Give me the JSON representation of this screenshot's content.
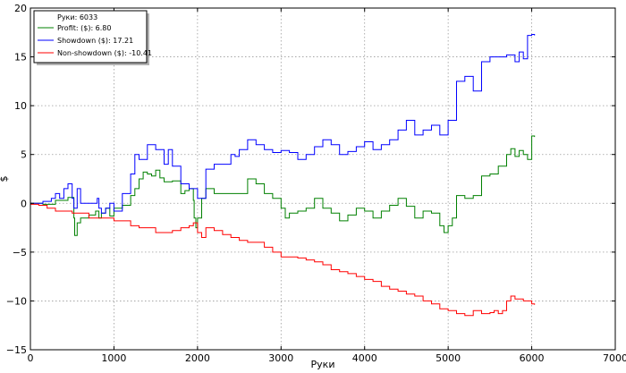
{
  "chart_data": {
    "type": "line",
    "xlabel": "Руки",
    "ylabel": "$",
    "xlim": [
      0,
      7000
    ],
    "ylim": [
      -15,
      20
    ],
    "xticks": [
      0,
      1000,
      2000,
      3000,
      4000,
      5000,
      6000,
      7000
    ],
    "yticks": [
      -15,
      -10,
      -5,
      0,
      5,
      10,
      15,
      20
    ],
    "grid": true,
    "legend_position": "top-left",
    "legend_header": "Руки: 6033",
    "series": [
      {
        "name": "Profit: ($): 6.80",
        "color": "#008000",
        "x": [
          0,
          150,
          300,
          450,
          520,
          530,
          560,
          600,
          700,
          780,
          820,
          850,
          900,
          950,
          1000,
          1100,
          1200,
          1250,
          1300,
          1350,
          1400,
          1450,
          1500,
          1550,
          1600,
          1700,
          1800,
          1850,
          1900,
          1950,
          1960,
          1980,
          2000,
          2050,
          2100,
          2200,
          2300,
          2400,
          2500,
          2600,
          2700,
          2800,
          2900,
          3000,
          3050,
          3100,
          3200,
          3300,
          3400,
          3500,
          3600,
          3700,
          3800,
          3900,
          4000,
          4100,
          4200,
          4300,
          4400,
          4500,
          4600,
          4700,
          4800,
          4900,
          4950,
          5000,
          5050,
          5100,
          5200,
          5300,
          5400,
          5500,
          5600,
          5700,
          5750,
          5800,
          5850,
          5900,
          5950,
          6000,
          6033
        ],
        "values": [
          0,
          -0.1,
          0.3,
          0.6,
          -1.5,
          -3.3,
          -2.0,
          -1.5,
          -1.2,
          -0.8,
          -1.5,
          -1.0,
          -0.5,
          -1.3,
          -0.5,
          -0.2,
          0.8,
          1.5,
          2.5,
          3.2,
          3.0,
          2.8,
          3.4,
          2.6,
          2.2,
          2.3,
          1.0,
          1.3,
          1.5,
          0.3,
          -1.5,
          -2.5,
          -1.5,
          0.5,
          1.5,
          1.0,
          1.0,
          1.0,
          1.0,
          2.5,
          2.0,
          1.0,
          0.5,
          -0.5,
          -1.5,
          -1.0,
          -0.8,
          -0.5,
          0.5,
          -0.5,
          -1.0,
          -1.8,
          -1.2,
          -0.5,
          -0.8,
          -1.5,
          -0.8,
          -0.2,
          0.5,
          -0.3,
          -1.5,
          -0.8,
          -1.0,
          -2.3,
          -3.0,
          -2.3,
          -1.5,
          0.8,
          0.5,
          0.8,
          2.8,
          3.0,
          3.8,
          5.0,
          5.6,
          4.8,
          5.4,
          5.0,
          4.5,
          6.9,
          6.8
        ]
      },
      {
        "name": "Showdown ($): 17.21",
        "color": "#0000ff",
        "x": [
          0,
          150,
          250,
          300,
          350,
          400,
          450,
          500,
          520,
          560,
          600,
          700,
          800,
          820,
          850,
          900,
          950,
          1000,
          1100,
          1200,
          1250,
          1300,
          1400,
          1500,
          1600,
          1650,
          1700,
          1800,
          1900,
          2000,
          2100,
          2200,
          2300,
          2400,
          2450,
          2500,
          2600,
          2700,
          2800,
          2900,
          3000,
          3100,
          3200,
          3300,
          3400,
          3500,
          3600,
          3700,
          3800,
          3900,
          4000,
          4100,
          4200,
          4300,
          4400,
          4500,
          4600,
          4700,
          4800,
          4900,
          5000,
          5100,
          5200,
          5300,
          5400,
          5500,
          5600,
          5700,
          5800,
          5850,
          5900,
          5950,
          6000,
          6033
        ],
        "values": [
          0,
          0.2,
          0.5,
          1.0,
          0.5,
          1.5,
          2.0,
          0.5,
          -0.5,
          1.5,
          0.0,
          0.0,
          0.5,
          -0.5,
          -1.0,
          -0.5,
          0.0,
          -0.8,
          1.0,
          3.0,
          5.0,
          4.5,
          6.0,
          5.5,
          4.0,
          5.5,
          3.8,
          2.0,
          1.5,
          0.5,
          3.5,
          4.0,
          4.0,
          5.0,
          4.8,
          5.5,
          6.5,
          6.0,
          5.5,
          5.2,
          5.4,
          5.2,
          4.5,
          5.0,
          5.8,
          6.5,
          6.0,
          5.0,
          5.3,
          5.8,
          6.3,
          5.5,
          6.0,
          6.5,
          7.5,
          8.5,
          7.0,
          7.5,
          8.0,
          7.0,
          8.5,
          12.5,
          13.0,
          11.5,
          14.5,
          15.0,
          15.0,
          15.2,
          14.5,
          15.5,
          14.8,
          17.2,
          17.3,
          17.2
        ]
      },
      {
        "name": "Non-showdown ($): -10.41",
        "color": "#ff0000",
        "x": [
          0,
          100,
          200,
          300,
          400,
          500,
          600,
          700,
          800,
          900,
          1000,
          1100,
          1200,
          1300,
          1400,
          1500,
          1600,
          1700,
          1800,
          1900,
          1950,
          2000,
          2050,
          2100,
          2200,
          2300,
          2400,
          2500,
          2600,
          2700,
          2800,
          2900,
          3000,
          3100,
          3200,
          3300,
          3400,
          3500,
          3600,
          3700,
          3800,
          3900,
          4000,
          4100,
          4200,
          4300,
          4400,
          4500,
          4600,
          4700,
          4800,
          4900,
          5000,
          5100,
          5200,
          5300,
          5400,
          5500,
          5550,
          5600,
          5650,
          5700,
          5750,
          5800,
          5900,
          6000,
          6033
        ],
        "values": [
          -0.1,
          -0.2,
          -0.5,
          -0.8,
          -0.8,
          -1.0,
          -1.0,
          -1.5,
          -1.5,
          -1.5,
          -1.8,
          -1.8,
          -2.3,
          -2.5,
          -2.5,
          -3.0,
          -3.0,
          -2.8,
          -2.5,
          -2.3,
          -2.0,
          -3.0,
          -3.5,
          -2.5,
          -2.8,
          -3.2,
          -3.5,
          -3.8,
          -4.0,
          -4.0,
          -4.5,
          -5.0,
          -5.5,
          -5.5,
          -5.6,
          -5.8,
          -6.0,
          -6.3,
          -6.8,
          -7.0,
          -7.2,
          -7.5,
          -7.8,
          -8.0,
          -8.5,
          -8.8,
          -9.0,
          -9.3,
          -9.5,
          -10.0,
          -10.3,
          -10.8,
          -11.0,
          -11.3,
          -11.5,
          -11.0,
          -11.3,
          -11.2,
          -11.0,
          -11.3,
          -11.0,
          -10.0,
          -9.5,
          -9.8,
          -10.0,
          -10.3,
          -10.4
        ]
      }
    ]
  }
}
